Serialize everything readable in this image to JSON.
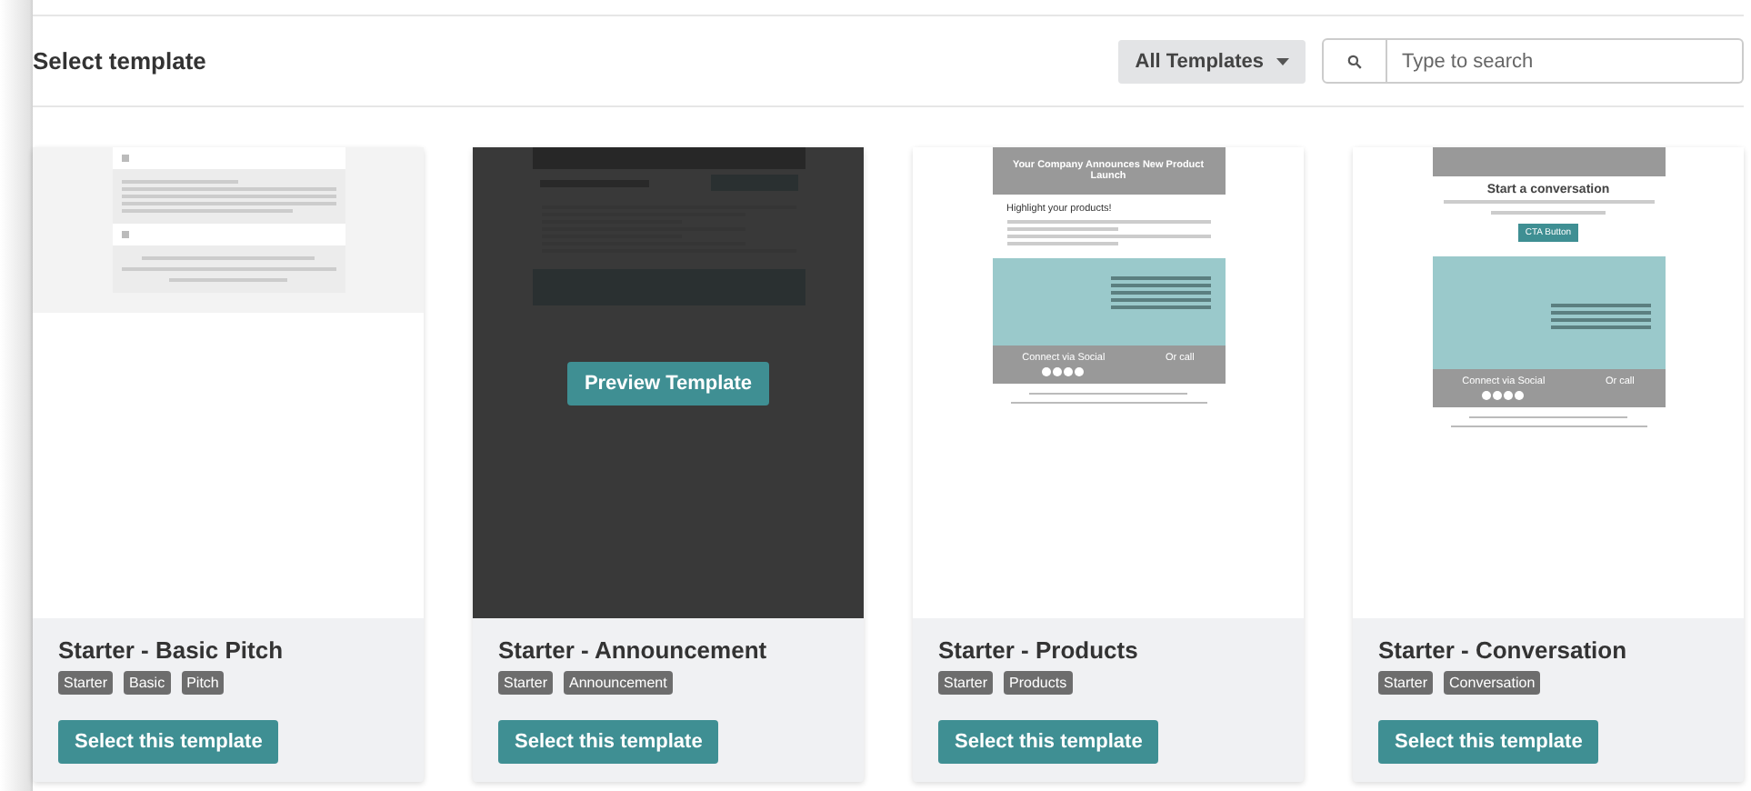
{
  "header": {
    "title": "Select template",
    "filter": {
      "label": "All Templates"
    },
    "search": {
      "placeholder": "Type to search"
    }
  },
  "templates": [
    {
      "name": "Starter - Basic Pitch",
      "tags": [
        "Starter",
        "Basic",
        "Pitch"
      ],
      "hovered": false,
      "button": "Select this template",
      "preview": {
        "kind": "basic"
      }
    },
    {
      "name": "Starter - Announcement",
      "tags": [
        "Starter",
        "Announcement"
      ],
      "hovered": true,
      "button": "Select this template",
      "overlay_button": "Preview Template",
      "preview": {
        "kind": "announcement"
      }
    },
    {
      "name": "Starter - Products",
      "tags": [
        "Starter",
        "Products"
      ],
      "hovered": false,
      "button": "Select this template",
      "preview": {
        "kind": "products",
        "banner": "Your Company Announces New Product Launch",
        "heading": "Highlight your products!",
        "social": "Connect via Social",
        "call": "Or call"
      }
    },
    {
      "name": "Starter - Conversation",
      "tags": [
        "Starter",
        "Conversation"
      ],
      "hovered": false,
      "button": "Select this template",
      "preview": {
        "kind": "conversation",
        "heading": "Start a conversation",
        "cta": "CTA Button",
        "social": "Connect via Social",
        "call": "Or call"
      }
    }
  ]
}
